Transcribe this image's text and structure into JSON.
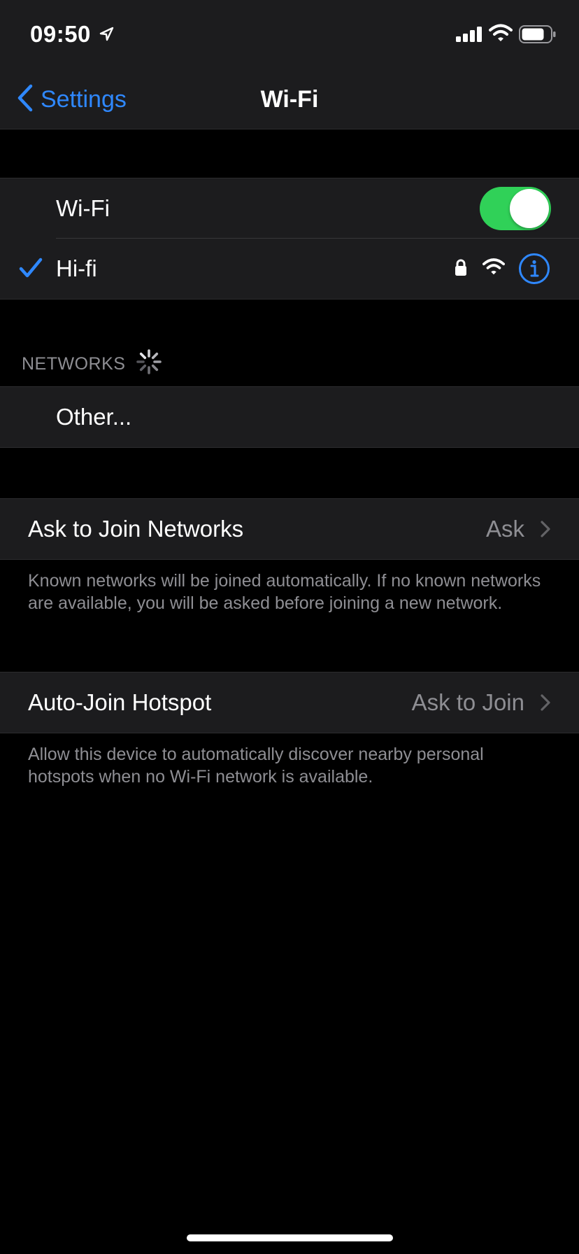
{
  "status_bar": {
    "time": "09:50",
    "icons": [
      "location-arrow-icon",
      "cellular-signal-icon",
      "wifi-icon",
      "battery-icon"
    ]
  },
  "nav": {
    "back_label": "Settings",
    "title": "Wi-Fi"
  },
  "wifi_section": {
    "wifi_label": "Wi-Fi",
    "wifi_enabled": true,
    "connected_network": "Hi-fi"
  },
  "networks": {
    "header": "NETWORKS",
    "other_label": "Other..."
  },
  "ask_to_join": {
    "label": "Ask to Join Networks",
    "value": "Ask",
    "footer": "Known networks will be joined automatically. If no known networks are available, you will be asked before joining a new network."
  },
  "auto_join": {
    "label": "Auto-Join Hotspot",
    "value": "Ask to Join",
    "footer": "Allow this device to automatically discover nearby personal hotspots when no Wi-Fi network is available."
  },
  "colors": {
    "accent": "#2f88ff",
    "toggle_on": "#30d158",
    "background": "#000000",
    "cell": "#1c1c1e",
    "secondary_text": "#8e8e93"
  }
}
